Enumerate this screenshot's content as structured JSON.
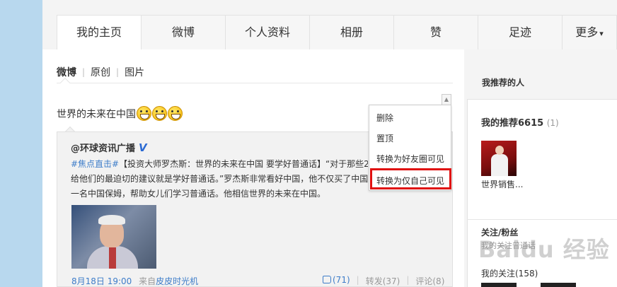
{
  "tabs": [
    {
      "label": "我的主页",
      "active": true
    },
    {
      "label": "微博"
    },
    {
      "label": "个人资料"
    },
    {
      "label": "相册"
    },
    {
      "label": "赞"
    },
    {
      "label": "足迹"
    },
    {
      "label": "更多",
      "caret": "▾"
    }
  ],
  "subnav": {
    "items": [
      "微博",
      "原创",
      "图片"
    ],
    "separator": "|"
  },
  "post": {
    "text": "世界的未来在中国",
    "emoji_count": 3
  },
  "repost": {
    "author": "@环球资讯广播",
    "verified_badge": "V",
    "hashtag": "#焦点直击#",
    "line1_rest": "【投资大师罗杰斯：世界的未来在中国 要学好普通话】“对于那些20",
    "line2": "给他们的最迫切的建议就是学好普通话。”罗杰斯非常看好中国，他不仅买了中国",
    "line3": "一名中国保姆，帮助女儿们学习普通话。他相信世界的未来在中国。",
    "time": "8月18日 19:00",
    "source_prefix": "来自",
    "source": "皮皮时光机",
    "likes": "(71)",
    "repost_label": "转发(37)",
    "comment_label": "评论(8)"
  },
  "menu": {
    "items": [
      "删除",
      "置顶",
      "转换为好友圈可见",
      "转换为仅自己可见"
    ],
    "highlight_color": "#e01010"
  },
  "sidebar": {
    "header": "我推荐的人",
    "recommend_title": "我的推荐6615",
    "recommend_count": "(1)",
    "user_name": "世界销售...",
    "fans_title": "关注/粉丝",
    "fans_sub": "我的关注普通话",
    "follow_label": "我的关注(158)"
  },
  "watermark": "Baidu 经验",
  "colors": {
    "link": "#3e7dc9",
    "background": "#b8d8ee"
  }
}
